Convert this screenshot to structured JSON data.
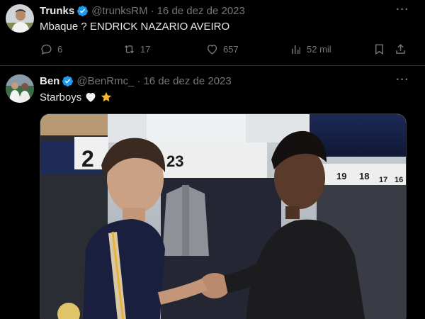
{
  "tweets": [
    {
      "display_name": "Trunks",
      "handle": "@trunksRM",
      "separator": "·",
      "date": "16 de dez de 2023",
      "text": "Mbaque ? ENDRICK NAZARIO AVEIRO",
      "more": "···",
      "actions": {
        "replies": "6",
        "reposts": "17",
        "likes": "657",
        "views": "52 mil"
      }
    },
    {
      "display_name": "Ben",
      "handle": "@BenRmc_",
      "separator": "·",
      "date": "16 de dez de 2023",
      "text": "Starboys",
      "emojis": [
        "white-heart",
        "star"
      ],
      "more": "···",
      "photo_labels": [
        "2",
        "23",
        "19",
        "18",
        "17",
        "16"
      ]
    }
  ],
  "colors": {
    "background": "#000000",
    "text": "#e7e9ea",
    "muted": "#71767b",
    "verified": "#1d9bf0",
    "divider": "#2f3336"
  }
}
